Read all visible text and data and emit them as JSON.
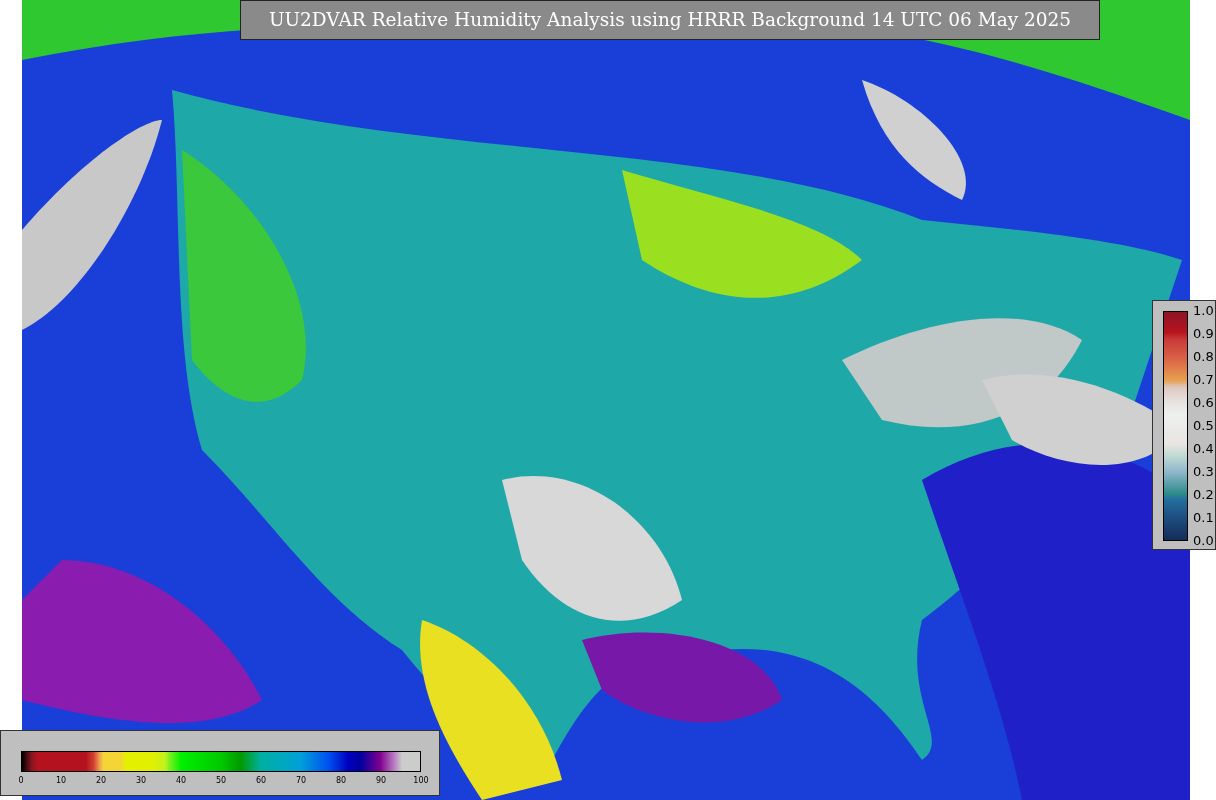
{
  "title": "UU2DVAR Relative Humidity Analysis using HRRR Background 14 UTC 06 May 2025",
  "humidity_colorbar": {
    "ticks": [
      "0",
      "10",
      "20",
      "30",
      "40",
      "50",
      "60",
      "70",
      "80",
      "90",
      "100"
    ]
  },
  "observation_colorbar": {
    "ticks": [
      "1.0",
      "0.9",
      "0.8",
      "0.7",
      "0.6",
      "0.5",
      "0.4",
      "0.3",
      "0.2",
      "0.1",
      "0.0"
    ]
  }
}
